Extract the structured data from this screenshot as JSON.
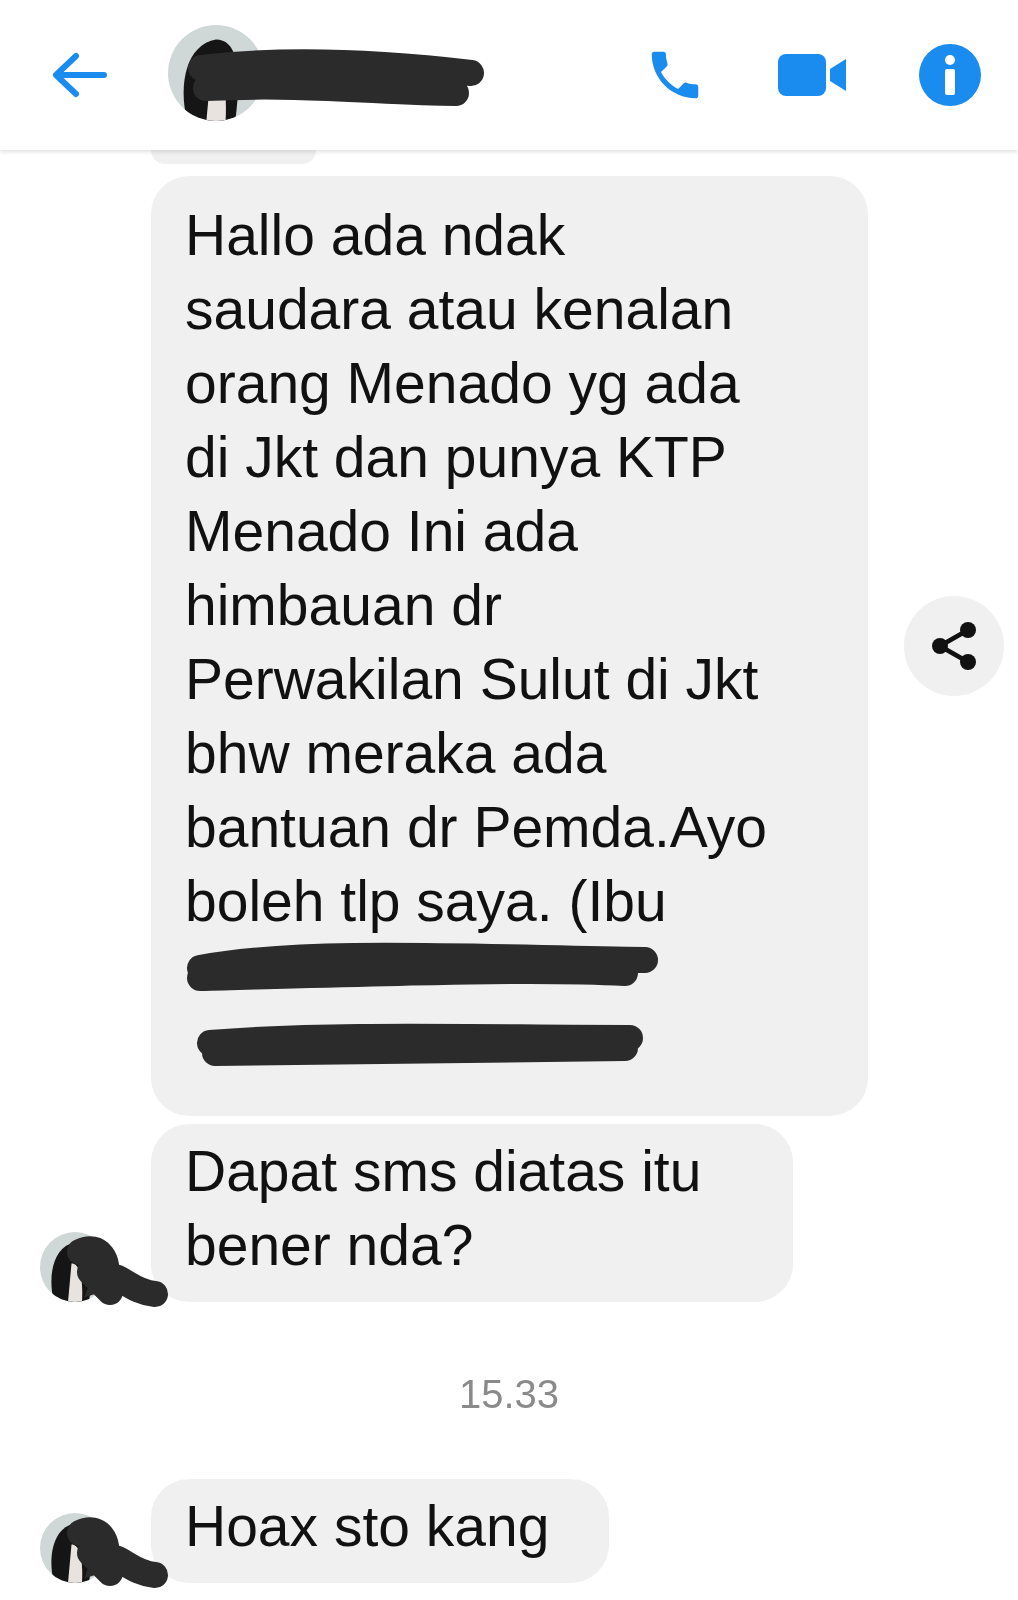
{
  "header": {
    "name_redacted": true
  },
  "thread": [
    {
      "kind": "stub"
    },
    {
      "kind": "message",
      "lines": [
        "Hallo ada ndak",
        "saudara atau kenalan",
        "orang Menado yg ada",
        "di Jkt dan punya KTP",
        "Menado Ini ada",
        "himbauan dr",
        "Perwakilan Sulut di Jkt",
        "bhw meraka ada",
        "bantuan dr Pemda.Ayo",
        "boleh tlp saya. (Ibu"
      ],
      "redacted": true,
      "avatar": false,
      "share": true
    },
    {
      "kind": "message",
      "lines": [
        "Dapat sms diatas itu",
        "bener nda?"
      ],
      "redacted": false,
      "avatar": true,
      "share": false
    },
    {
      "kind": "time",
      "text": "15.33"
    },
    {
      "kind": "message",
      "lines": [
        "Hoax sto kang"
      ],
      "redacted": false,
      "avatar": true,
      "share": false
    }
  ]
}
